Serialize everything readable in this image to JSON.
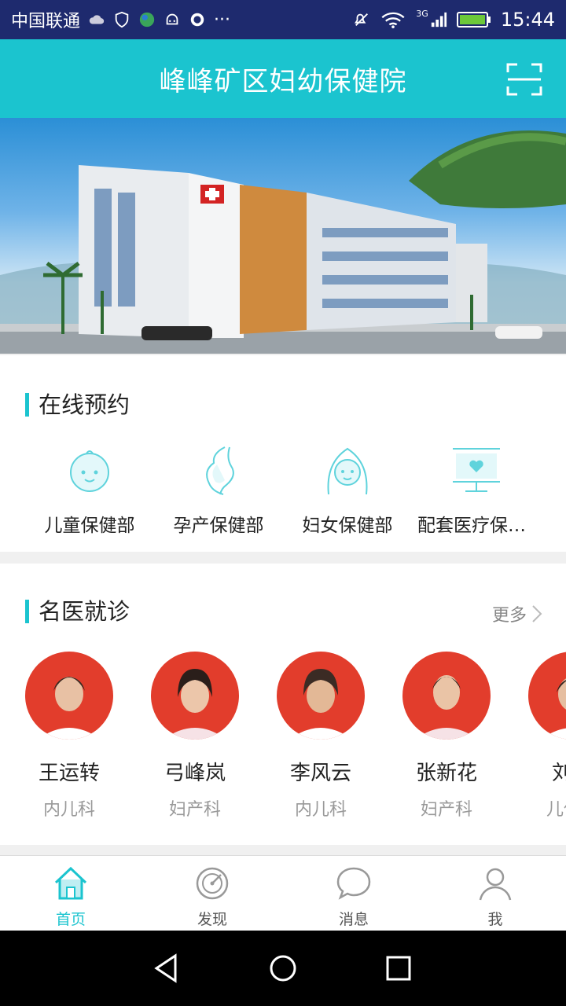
{
  "status": {
    "carrier": "中国联通",
    "network": "3G",
    "time": "15:44"
  },
  "header": {
    "title": "峰峰矿区妇幼保健院"
  },
  "booking": {
    "title": "在线预约",
    "items": [
      {
        "label": "儿童保健部",
        "icon": "baby-face-icon"
      },
      {
        "label": "孕产保健部",
        "icon": "pregnancy-icon"
      },
      {
        "label": "妇女保健部",
        "icon": "woman-face-icon"
      },
      {
        "label": "配套医疗保健部",
        "icon": "medical-monitor-icon"
      }
    ]
  },
  "doctors": {
    "title": "名医就诊",
    "more": "更多",
    "list": [
      {
        "name": "王运转",
        "dept": "内儿科"
      },
      {
        "name": "弓峰岚",
        "dept": "妇产科"
      },
      {
        "name": "李风云",
        "dept": "内儿科"
      },
      {
        "name": "张新花",
        "dept": "妇产科"
      },
      {
        "name": "刘秀",
        "dept": "儿保科"
      }
    ]
  },
  "tabs": [
    {
      "label": "首页",
      "icon": "home-icon",
      "active": true
    },
    {
      "label": "发现",
      "icon": "discover-icon",
      "active": false
    },
    {
      "label": "消息",
      "icon": "message-icon",
      "active": false
    },
    {
      "label": "我",
      "icon": "profile-icon",
      "active": false
    }
  ],
  "colors": {
    "accent": "#1bc4cf",
    "statusbar": "#1e2a6e",
    "avatar_bg": "#e23d2c"
  }
}
